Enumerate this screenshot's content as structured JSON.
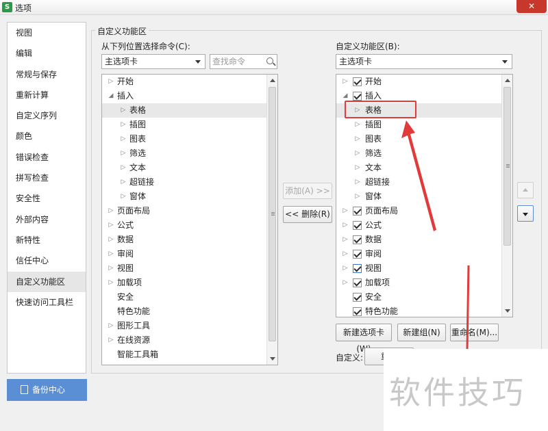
{
  "window": {
    "title": "选项",
    "app_icon_letter": "S",
    "close_symbol": "✕"
  },
  "nav": {
    "items": [
      "视图",
      "编辑",
      "常规与保存",
      "重新计算",
      "自定义序列",
      "颜色",
      "错误检查",
      "拼写检查",
      "安全性",
      "外部内容",
      "新特性",
      "信任中心",
      "自定义功能区",
      "快速访问工具栏"
    ],
    "active": "自定义功能区"
  },
  "backup_button": "备份中心",
  "group_title": "自定义功能区",
  "left_panel": {
    "label": "从下列位置选择命令(C):",
    "combo_value": "主选项卡",
    "search_placeholder": "查找命令",
    "tree": [
      "开始",
      "插入",
      "表格",
      "插图",
      "图表",
      "筛选",
      "文本",
      "超链接",
      "窗体",
      "页面布局",
      "公式",
      "数据",
      "审阅",
      "视图",
      "加载项",
      "安全",
      "特色功能",
      "图形工具",
      "在线资源",
      "智能工具箱"
    ]
  },
  "middle": {
    "add_button": "添加(A) >>",
    "remove_button": "<< 删除(R)"
  },
  "right_panel": {
    "label": "自定义功能区(B):",
    "combo_value": "主选项卡",
    "tree": [
      "开始",
      "插入",
      "表格",
      "插图",
      "图表",
      "筛选",
      "文本",
      "超链接",
      "窗体",
      "页面布局",
      "公式",
      "数据",
      "审阅",
      "视图",
      "加载项",
      "安全",
      "特色功能"
    ]
  },
  "bottom_buttons": {
    "new_tab": "新建选项卡(W)",
    "new_group": "新建组(N)",
    "rename": "重命名(M)..."
  },
  "customize": {
    "label": "自定义:",
    "reset_button": "重置"
  },
  "watermark": "软件技巧",
  "colors": {
    "accent_blue": "#5a8fd6",
    "annotation_red": "#e03a3a",
    "close_red": "#c7372b"
  },
  "icons": {
    "close": "close-icon",
    "search": "search-icon",
    "backup": "backup-icon",
    "expand": "triangle-right-icon",
    "collapse": "triangle-down-icon",
    "checkbox": "checkbox-checked-icon"
  }
}
